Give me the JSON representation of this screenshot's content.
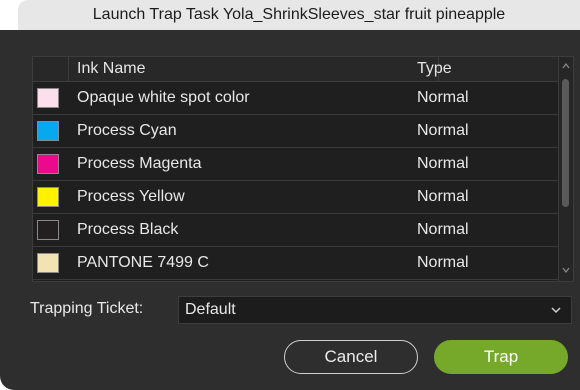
{
  "window": {
    "title": "Launch Trap Task Yola_ShrinkSleeves_star fruit pineapple"
  },
  "table": {
    "columns": [
      "",
      "Ink Name",
      "Type"
    ],
    "rows": [
      {
        "name": "Opaque white spot color",
        "type": "Normal",
        "color": "#fcdfea"
      },
      {
        "name": "Process Cyan",
        "type": "Normal",
        "color": "#08a8ee"
      },
      {
        "name": "Process Magenta",
        "type": "Normal",
        "color": "#ec0a8c"
      },
      {
        "name": "Process Yellow",
        "type": "Normal",
        "color": "#fff200"
      },
      {
        "name": "Process Black",
        "type": "Normal",
        "color": "#231f20"
      },
      {
        "name": "PANTONE 7499 C",
        "type": "Normal",
        "color": "#f3e3b3"
      }
    ]
  },
  "ticket": {
    "label": "Trapping Ticket:",
    "value": "Default"
  },
  "buttons": {
    "cancel": "Cancel",
    "trap": "Trap"
  },
  "colors": {
    "accent": "#76a82a",
    "panel": "#2e2e2e"
  }
}
